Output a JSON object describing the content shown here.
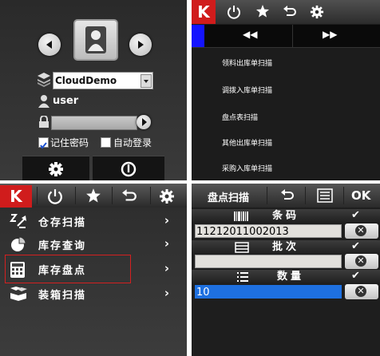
{
  "login": {
    "server": "CloudDemo",
    "username": "user",
    "password": "",
    "remember_label": "记住密码",
    "auto_login_label": "自动登录",
    "remember_checked": true,
    "auto_login_checked": false
  },
  "menu_list": {
    "items": [
      "领料出库单扫描",
      "调拨入库单扫描",
      "盘点表扫描",
      "其他出库单扫描",
      "采购入库单扫描"
    ]
  },
  "main_menu": {
    "k_label": "K",
    "items": [
      {
        "label": "仓存扫描",
        "icon": "warehouse-scan-icon"
      },
      {
        "label": "库存查询",
        "icon": "pie-chart-icon"
      },
      {
        "label": "库存盘点",
        "icon": "calculator-icon"
      },
      {
        "label": "装箱扫描",
        "icon": "boxes-icon"
      }
    ],
    "chevron": "›"
  },
  "scan_form": {
    "title": "盘点扫描",
    "ok_label": "OK",
    "barcode_label": "条码",
    "barcode_value": "11212011002013",
    "batch_label": "批次",
    "batch_value": "",
    "quantity_label": "数量",
    "quantity_value": "10"
  },
  "colors": {
    "accent_red": "#d01c1c",
    "selection_blue": "#1e70e0",
    "nav_blue": "#1414ff"
  }
}
